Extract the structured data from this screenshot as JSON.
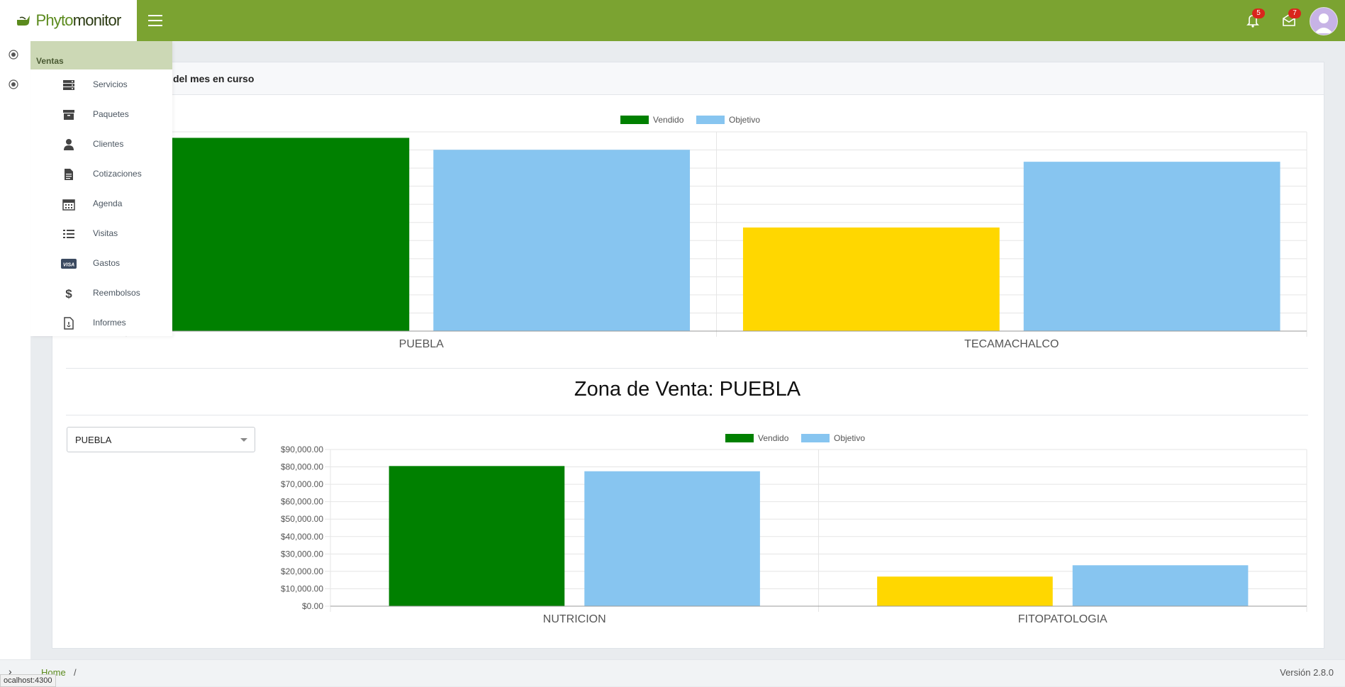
{
  "brand": {
    "name_part1": "Phyto",
    "name_part2": "monitor"
  },
  "topbar": {
    "notifications_count": "5",
    "messages_count": "7"
  },
  "card": {
    "header_title": "del mes en curso"
  },
  "chart1": {
    "legend": [
      {
        "label": "Vendido",
        "color": "#008000"
      },
      {
        "label": "Objetivo",
        "color": "#87c5f0"
      }
    ],
    "categories": [
      "PUEBLA",
      "TECAMACHALCO"
    ]
  },
  "zone": {
    "title": "Zona de Venta: PUEBLA",
    "select_value": "PUEBLA"
  },
  "chart2": {
    "legend": [
      {
        "label": "Vendido",
        "color": "#008000"
      },
      {
        "label": "Objetivo",
        "color": "#87c5f0"
      }
    ],
    "y_ticks": [
      "$90,000.00",
      "$80,000.00",
      "$70,000.00",
      "$60,000.00",
      "$50,000.00",
      "$40,000.00",
      "$30,000.00",
      "$20,000.00",
      "$10,000.00",
      "$0.00"
    ],
    "categories": [
      "NUTRICION",
      "FITOPATOLOGIA"
    ]
  },
  "chart_data": [
    {
      "type": "bar",
      "title": "",
      "categories": [
        "PUEBLA",
        "TECAMACHALCO"
      ],
      "series": [
        {
          "name": "Vendido",
          "values": [
            97,
            52
          ],
          "colors": [
            "#008000",
            "#ffd700"
          ]
        },
        {
          "name": "Objetivo",
          "values": [
            91,
            85
          ],
          "colors": [
            "#87c5f0",
            "#87c5f0"
          ]
        }
      ],
      "ylim": [
        0,
        100
      ],
      "grid": true,
      "legend_position": "top"
    },
    {
      "type": "bar",
      "title": "",
      "categories": [
        "NUTRICION",
        "FITOPATOLOGIA"
      ],
      "series": [
        {
          "name": "Vendido",
          "values": [
            80500,
            17000
          ],
          "colors": [
            "#008000",
            "#ffd700"
          ]
        },
        {
          "name": "Objetivo",
          "values": [
            77500,
            23500
          ],
          "colors": [
            "#87c5f0",
            "#87c5f0"
          ]
        }
      ],
      "ylim": [
        0,
        90000
      ],
      "grid": true,
      "legend_position": "top"
    }
  ],
  "sidebar": {
    "header": "Ventas",
    "items": [
      {
        "label": "Servicios",
        "icon": "server-icon"
      },
      {
        "label": "Paquetes",
        "icon": "archive-icon"
      },
      {
        "label": "Clientes",
        "icon": "user-icon"
      },
      {
        "label": "Cotizaciones",
        "icon": "document-icon"
      },
      {
        "label": "Agenda",
        "icon": "calendar-icon"
      },
      {
        "label": "Visitas",
        "icon": "list-icon"
      },
      {
        "label": "Gastos",
        "icon": "visa-card-icon"
      },
      {
        "label": "Reembolsos",
        "icon": "dollar-icon"
      },
      {
        "label": "Informes",
        "icon": "report-icon"
      }
    ]
  },
  "footer": {
    "breadcrumb_home": "Home",
    "separator": "/",
    "version": "Versión 2.8.0"
  },
  "status": {
    "url": "ocalhost:4300"
  }
}
